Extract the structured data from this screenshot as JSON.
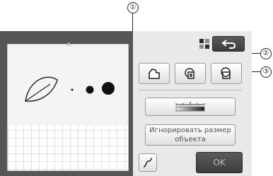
{
  "callouts": [
    "①",
    "②",
    "③"
  ],
  "toolbar": {
    "back_icon": "back-arrow-icon",
    "view_toggle_icon": "grid-view-icon"
  },
  "outline_buttons": [
    {
      "icon": "outline-shape-icon"
    },
    {
      "icon": "inner-outline-shape-icon"
    },
    {
      "icon": "overlapping-outline-shape-icon"
    }
  ],
  "threshold": {
    "icon": "threshold-slider-icon"
  },
  "ignore_size": {
    "label": "Игнорировать размер\nобъекта"
  },
  "line_tool": {
    "icon": "freehand-line-icon"
  },
  "ok": {
    "label": "OK"
  },
  "colors": {
    "accent_panel": "#e9e9e9",
    "device_frame": "#555555",
    "ok_disabled": "#3c3c3c"
  }
}
